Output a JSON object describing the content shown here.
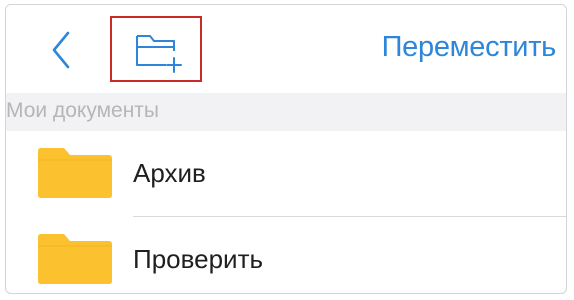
{
  "toolbar": {
    "back_icon": "chevron-left-icon",
    "new_folder_icon": "folder-plus-icon",
    "move_label": "Переместить",
    "accent_color": "#2d86d9",
    "highlight_color": "#c92a2a"
  },
  "section": {
    "title": "Мои документы"
  },
  "folders": [
    {
      "icon": "folder-icon",
      "label": "Архив"
    },
    {
      "icon": "folder-icon",
      "label": "Проверить"
    }
  ],
  "folder_color": "#fcc12f"
}
